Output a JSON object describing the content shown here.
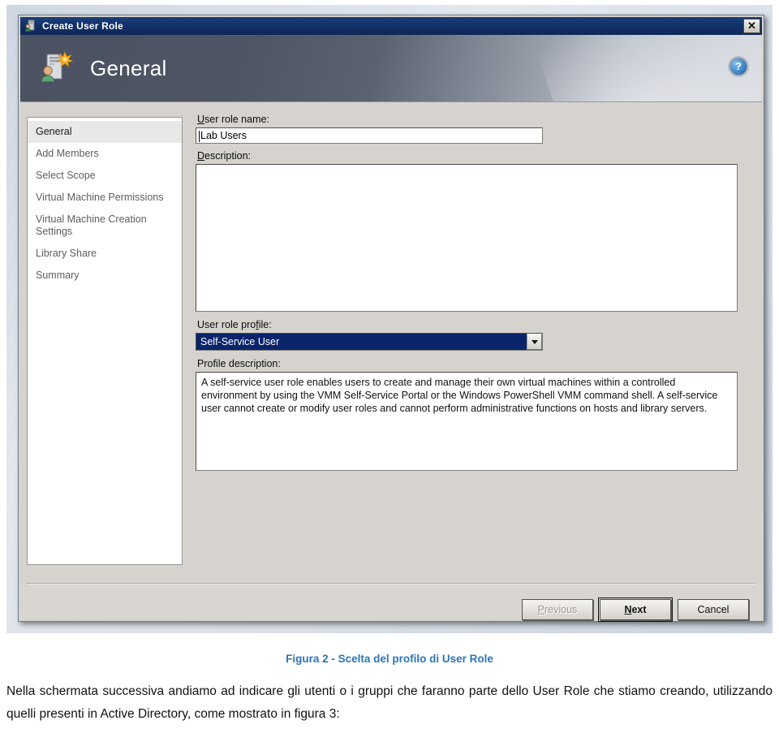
{
  "window": {
    "title": "Create User Role",
    "titlebar_icon": "user-role-icon",
    "close_label": "✕",
    "banner_title": "General",
    "banner_icon": "server-user-new-icon",
    "help_label": "?"
  },
  "sidebar": {
    "items": [
      {
        "label": "General",
        "selected": true
      },
      {
        "label": "Add Members",
        "selected": false
      },
      {
        "label": "Select Scope",
        "selected": false
      },
      {
        "label": "Virtual Machine Permissions",
        "selected": false
      },
      {
        "label": "Virtual Machine Creation Settings",
        "selected": false
      },
      {
        "label": "Library Share",
        "selected": false
      },
      {
        "label": "Summary",
        "selected": false
      }
    ]
  },
  "form": {
    "user_role_name": {
      "label_accel": "U",
      "label_rest": "ser role name:",
      "value": "Lab Users",
      "placeholder": ""
    },
    "description": {
      "label_accel": "D",
      "label_rest": "escription:",
      "value": "",
      "placeholder": ""
    },
    "user_role_profile": {
      "label_pre": "User role pro",
      "label_accel": "f",
      "label_post": "ile:",
      "selected": "Self-Service User",
      "options": [
        "Self-Service User"
      ]
    },
    "profile_description": {
      "label": "Profile description:",
      "text": "A self-service user role enables users to create and manage their own virtual machines within a controlled environment by using the VMM Self-Service Portal or the Windows PowerShell VMM command shell. A self-service user cannot create or modify user roles and cannot perform administrative functions on hosts and library servers."
    }
  },
  "footer": {
    "previous": {
      "label": "Previous",
      "accel": "P",
      "rest": "revious",
      "disabled": true
    },
    "next": {
      "label": "Next",
      "accel": "N",
      "rest": "ext",
      "default": true
    },
    "cancel": {
      "label": "Cancel",
      "disabled": false
    }
  },
  "document": {
    "figure_caption": "Figura 2 - Scelta del profilo di User Role",
    "paragraph": "Nella schermata successiva andiamo ad indicare gli utenti o i gruppi che faranno parte dello User Role che stiamo creando, utilizzando quelli presenti in Active Directory, come mostrato in figura 3:"
  },
  "colors": {
    "titlebar": "#123169",
    "combo_selection": "#0a246a",
    "caption_blue": "#2e74b5",
    "dialog_face": "#d6d3ce"
  }
}
